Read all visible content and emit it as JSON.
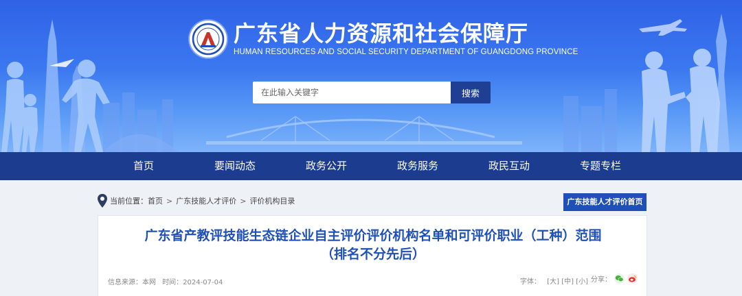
{
  "header": {
    "title_cn": "广东省人力资源和社会保障厅",
    "title_en": "HUMAN RESOURCES AND SOCIAL SECURITY DEPARTMENT OF GUANGDONG PROVINCE",
    "emblem_icon": "department-emblem"
  },
  "search": {
    "placeholder": "在此输入关键字",
    "button_label": "搜索"
  },
  "nav": {
    "items": [
      {
        "label": "首页"
      },
      {
        "label": "要闻动态"
      },
      {
        "label": "政务公开"
      },
      {
        "label": "政务服务"
      },
      {
        "label": "政民互动"
      },
      {
        "label": "专题专栏"
      }
    ]
  },
  "breadcrumb": {
    "prefix": "当前位置：",
    "items": [
      "首页",
      "广东技能人才评价",
      "评价机构目录"
    ],
    "separator": ">",
    "icon": "location-pin-icon"
  },
  "talent_home_button": "广东技能人才评价首页",
  "article": {
    "title_line1": "广东省产教评技能生态链企业自主评价评价机构名单和可评价职业（工种）范围",
    "title_line2": "（排名不分先后）",
    "source_label": "信息来源：",
    "source_value": "本网",
    "time_label": "时间：",
    "time_value": "2024-07-04",
    "font_size_label": "字体：",
    "font_sizes": [
      "[大]",
      "[中]",
      "[小]"
    ],
    "share_label": "分享："
  },
  "colors": {
    "nav_bg": "#1c3d8f",
    "accent_blue": "#1f50b8",
    "search_button": "#1f3f94"
  }
}
